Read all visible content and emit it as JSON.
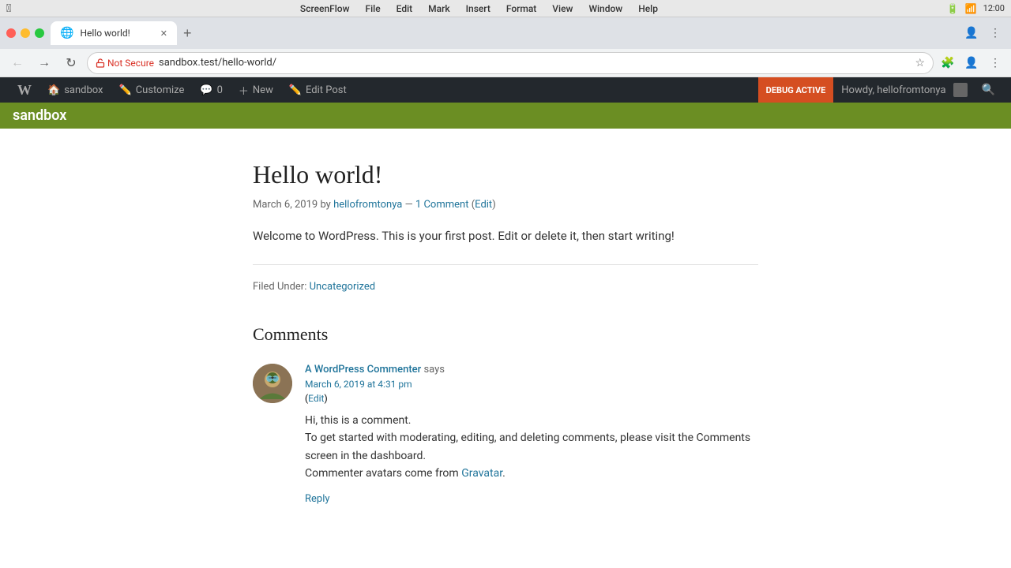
{
  "macos": {
    "app": "ScreenFlow",
    "menu_items": [
      "ScreenFlow",
      "File",
      "Edit",
      "Mark",
      "Insert",
      "Format",
      "View",
      "Window",
      "Help"
    ]
  },
  "browser": {
    "tab_title": "Hello world!",
    "url_not_secure": "Not Secure",
    "url": "sandbox.test/hello-world/",
    "back_btn": "←",
    "forward_btn": "→",
    "refresh_btn": "↻",
    "new_tab_btn": "+"
  },
  "wp_admin_bar": {
    "wp_logo": "W",
    "site_name": "sandbox",
    "customize": "Customize",
    "comments_count": "0",
    "new_label": "New",
    "edit_post": "Edit Post",
    "debug_active": "DEBUG ACTIVE",
    "howdy": "Howdy, hellofromtonya"
  },
  "site": {
    "name": "sandbox"
  },
  "post": {
    "title": "Hello world!",
    "date": "March 6, 2019",
    "by": "by",
    "author": "hellofromtonya",
    "comment_count": "1 Comment",
    "edit": "Edit",
    "content": "Welcome to WordPress. This is your first post. Edit or delete it, then start writing!",
    "filed_under": "Filed Under:",
    "category": "Uncategorized"
  },
  "comments": {
    "title": "Comments",
    "comment": {
      "author": "A WordPress Commenter",
      "says": "says",
      "date": "March 6, 2019 at 4:31 pm",
      "edit": "Edit",
      "text_line1": "Hi, this is a comment.",
      "text_line2": "To get started with moderating, editing, and deleting comments, please visit the Comments screen in the dashboard.",
      "text_line3": "Commenter avatars come from",
      "gravatar_link": "Gravatar",
      "text_line3_end": ".",
      "reply": "Reply"
    }
  }
}
